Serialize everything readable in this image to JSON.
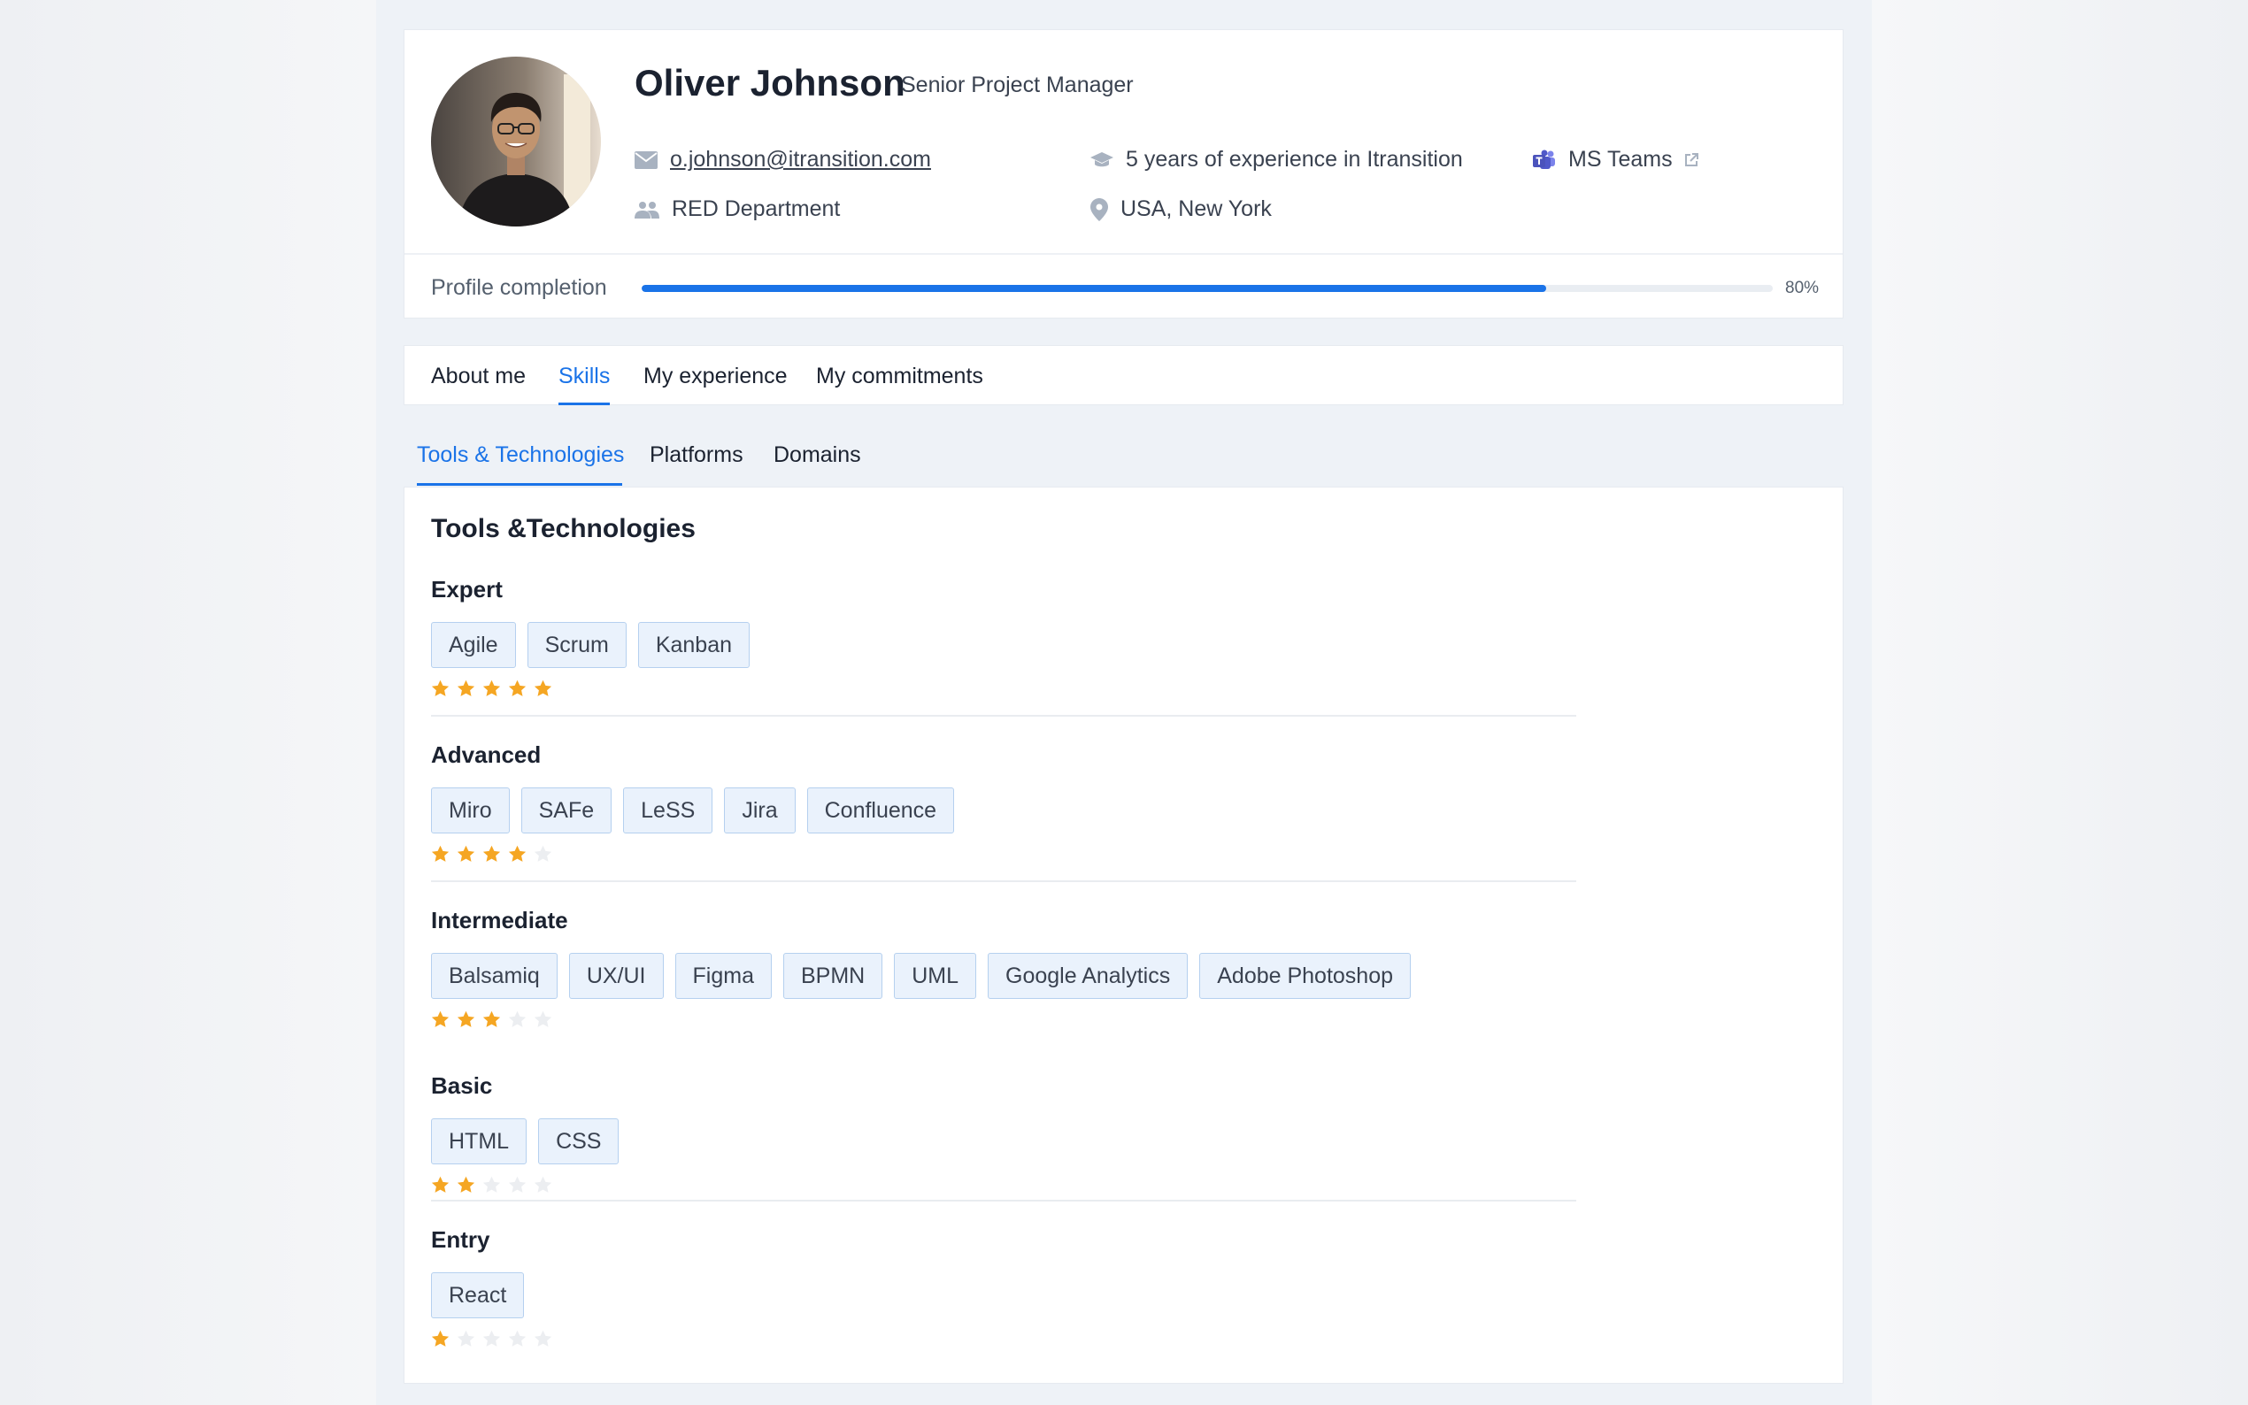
{
  "profile": {
    "name": "Oliver Johnson",
    "role": "Senior Project Manager",
    "email": "o.johnson@itransition.com",
    "experience": "5 years of experience in Itransition",
    "teams": "MS Teams",
    "department": "RED Department",
    "location": "USA, New York",
    "avatar_icon": "profile-photo"
  },
  "completion": {
    "label": "Profile completion",
    "value_text": "80%",
    "fraction": 0.8,
    "accent": "#1a73e8"
  },
  "tabs": [
    {
      "label": "About me",
      "active": false
    },
    {
      "label": "Skills",
      "active": true
    },
    {
      "label": "My experience",
      "active": false
    },
    {
      "label": "My commitments",
      "active": false
    }
  ],
  "subtabs": [
    {
      "label": "Tools & Technologies",
      "active": true
    },
    {
      "label": "Platforms",
      "active": false
    },
    {
      "label": "Domains",
      "active": false
    }
  ],
  "skills": {
    "title": "Tools &Technologies",
    "star_color": "#f5a623",
    "levels": [
      {
        "name": "Expert",
        "rating": 5,
        "chips": [
          "Agile",
          "Scrum",
          "Kanban"
        ]
      },
      {
        "name": "Advanced",
        "rating": 4,
        "chips": [
          "Miro",
          "SAFe",
          "LeSS",
          "Jira",
          "Confluence"
        ]
      },
      {
        "name": "Intermediate",
        "rating": 3,
        "chips": [
          "Balsamiq",
          "UX/UI",
          "Figma",
          "BPMN",
          "UML",
          "Google Analytics",
          "Adobe Photoshop"
        ]
      },
      {
        "name": "Basic",
        "rating": 2,
        "chips": [
          "HTML",
          "CSS"
        ]
      },
      {
        "name": "Entry",
        "rating": 1,
        "chips": [
          "React"
        ]
      }
    ]
  }
}
